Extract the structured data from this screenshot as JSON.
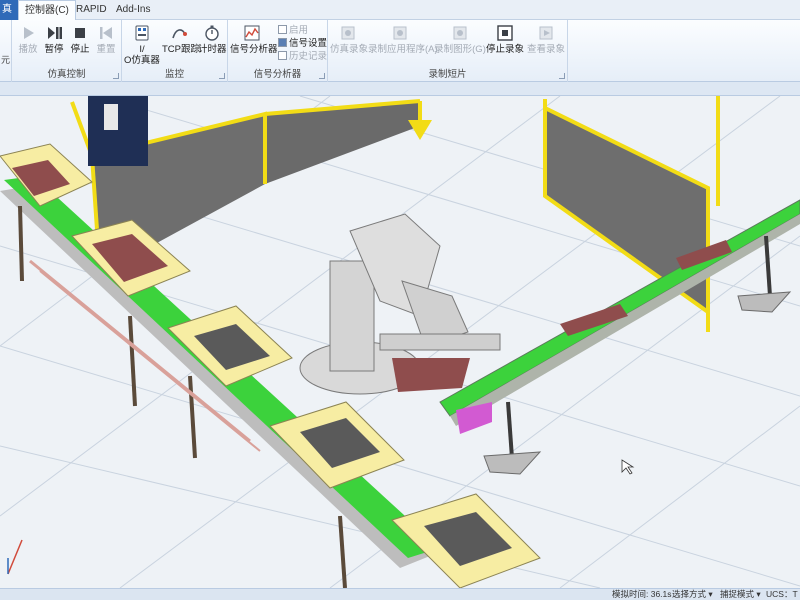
{
  "menubar": {
    "file_tab": "真",
    "tabs": [
      {
        "label": "控制器(C)",
        "active": true
      },
      {
        "label": "RAPID",
        "active": false
      },
      {
        "label": "Add-Ins",
        "active": false
      }
    ]
  },
  "ribbon": {
    "left_stub": "元",
    "groups": {
      "sim_control": {
        "label": "仿真控制",
        "buttons": [
          {
            "label": "播放",
            "icon": "play-icon",
            "enabled": false
          },
          {
            "label": "暂停",
            "icon": "pause-icon",
            "enabled": true
          },
          {
            "label": "停止",
            "icon": "stop-icon",
            "enabled": true
          },
          {
            "label": "重置",
            "icon": "reset-icon",
            "enabled": false
          }
        ]
      },
      "monitor": {
        "label": "监控",
        "buttons": [
          {
            "label_line1": "I/",
            "label_line2": "O仿真器",
            "icon": "io-simulator-icon"
          },
          {
            "label": "TCP跟踪",
            "icon": "tcp-trace-icon"
          },
          {
            "label": "计时器",
            "icon": "stopwatch-icon"
          }
        ]
      },
      "signal_analyzer": {
        "label": "信号分析器",
        "button": {
          "label": "信号分析器",
          "icon": "signal-chart-icon"
        },
        "small_items": [
          {
            "label": "启用",
            "enabled": false
          },
          {
            "label": "信号设置",
            "enabled": true
          },
          {
            "label": "历史记录",
            "enabled": false
          }
        ]
      },
      "record_short": {
        "label": "录制短片",
        "buttons": [
          {
            "label": "仿真录象",
            "icon": "record-sim-icon",
            "enabled": false
          },
          {
            "label": "录制应用程序(A)",
            "icon": "record-app-icon",
            "enabled": false
          },
          {
            "label": "录制图形(G)",
            "icon": "record-graphics-icon",
            "enabled": false
          },
          {
            "label": "停止录象",
            "icon": "stop-record-icon",
            "enabled": true
          },
          {
            "label": "查看录象",
            "icon": "view-record-icon",
            "enabled": false
          }
        ]
      }
    }
  },
  "statusbar": {
    "sim_time": "模拟时间: 36.1s",
    "selection_mode": "选择方式 ▾",
    "snap_mode": "捕捉模式 ▾",
    "ucs": "UCS：T"
  },
  "colors": {
    "conveyor_belt": "#3cd23c",
    "fence_frame": "#f2dc16",
    "fence_panel": "#6e6e6e",
    "box": "#f7eda3",
    "robot": "#d9d9d9",
    "floor": "#eef2f6"
  }
}
